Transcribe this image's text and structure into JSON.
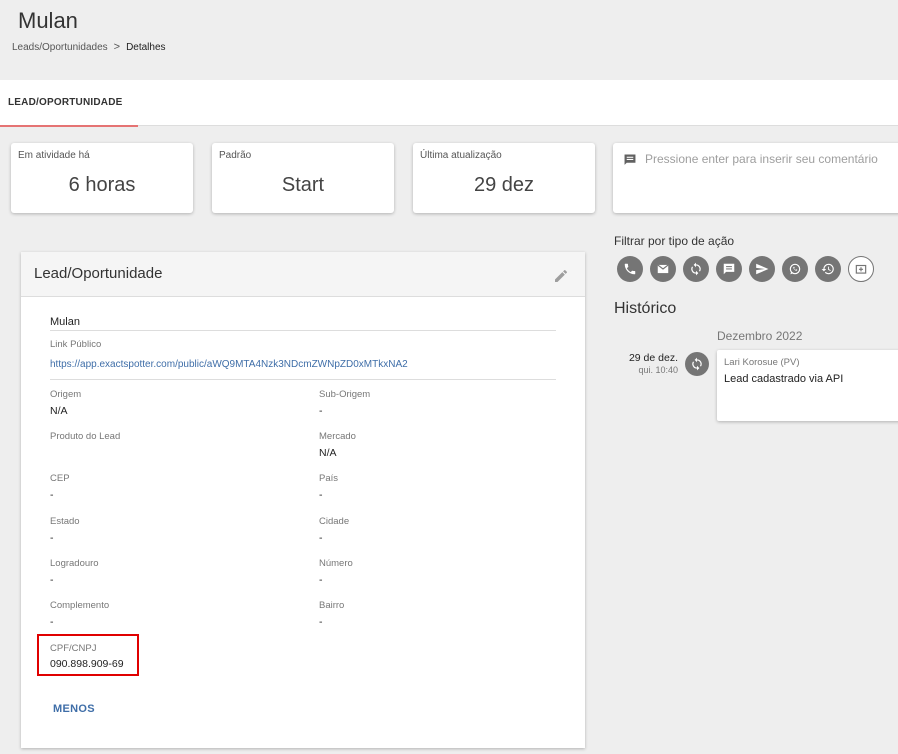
{
  "page": {
    "title": "Mulan"
  },
  "breadcrumb": {
    "parent": "Leads/Oportunidades",
    "separator": ">",
    "current": "Detalhes"
  },
  "tabs": [
    {
      "label": "LEAD/OPORTUNIDADE",
      "active": true
    }
  ],
  "stats": [
    {
      "label": "Em atividade há",
      "value": "6 horas"
    },
    {
      "label": "Padrão",
      "value": "Start"
    },
    {
      "label": "Última atualização",
      "value": "29 dez"
    }
  ],
  "comment": {
    "placeholder": "Pressione enter para inserir seu comentário",
    "icon": "comment-icon"
  },
  "lead": {
    "header": "Lead/Oportunidade",
    "name": "Mulan",
    "public_link_label": "Link Público",
    "public_link": "https://app.exactspotter.com/public/aWQ9MTA4Nzk3NDcmZWNpZD0xMTkxNA2",
    "fields": {
      "origem": {
        "label": "Origem",
        "value": "N/A"
      },
      "sub_origem": {
        "label": "Sub-Origem",
        "value": "-"
      },
      "produto": {
        "label": "Produto do Lead",
        "value": ""
      },
      "mercado": {
        "label": "Mercado",
        "value": "N/A"
      },
      "cep": {
        "label": "CEP",
        "value": "-"
      },
      "pais": {
        "label": "País",
        "value": "-"
      },
      "estado": {
        "label": "Estado",
        "value": "-"
      },
      "cidade": {
        "label": "Cidade",
        "value": "-"
      },
      "logradouro": {
        "label": "Logradouro",
        "value": "-"
      },
      "numero": {
        "label": "Número",
        "value": "-"
      },
      "complemento": {
        "label": "Complemento",
        "value": "-"
      },
      "bairro": {
        "label": "Bairro",
        "value": "-"
      },
      "cpf": {
        "label": "CPF/CNPJ",
        "value": "090.898.909-69"
      }
    },
    "toggle_label": "MENOS",
    "highlight_color": "#e00000"
  },
  "filter": {
    "label": "Filtrar por tipo de ação",
    "icons": [
      "phone-icon",
      "email-icon",
      "sync-icon",
      "message-icon",
      "send-icon",
      "whatsapp-icon",
      "history-icon",
      "add-box-icon"
    ]
  },
  "history": {
    "title": "Histórico",
    "month": "Dezembro 2022",
    "entries": [
      {
        "date": "29 de dez.",
        "time": "qui. 10:40",
        "author": "Lari Korosue (PV)",
        "description": "Lead cadastrado via API",
        "icon": "sync-icon"
      }
    ]
  },
  "colors": {
    "accent_link": "#3f6ea8",
    "tab_underline": "#e57373",
    "icon_gray": "#757575"
  }
}
